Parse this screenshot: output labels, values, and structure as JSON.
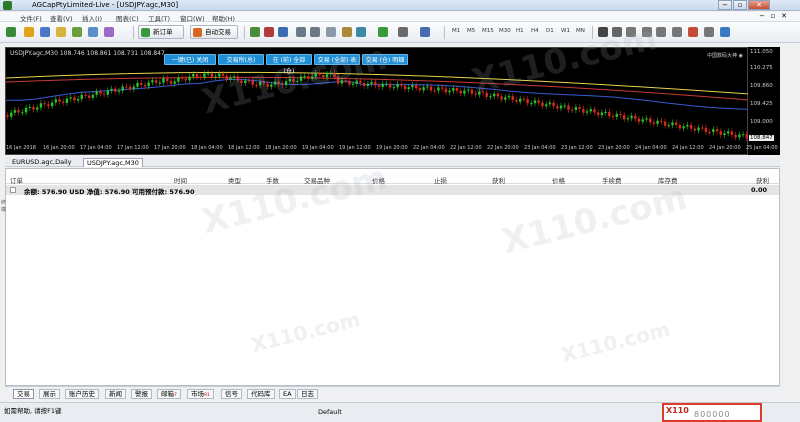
{
  "window": {
    "title": "AGCapPtyLimited-Live - [USDJPY.agc,M30]",
    "min_glyph": "−",
    "max_glyph": "▫",
    "close_glyph": "✕"
  },
  "menu": {
    "items": [
      "文件(F)",
      "查看(V)",
      "插入(I)",
      "图表(C)",
      "工具(T)",
      "窗口(W)",
      "帮助(H)"
    ],
    "right_min": "−",
    "right_restore": "▫",
    "right_close": "✕"
  },
  "toolbar": {
    "new_order_label": "新订单",
    "auto_trade_label": "自动交易",
    "timeframes": [
      "M1",
      "M5",
      "M15",
      "M30",
      "H1",
      "H4",
      "D1",
      "W1",
      "MN"
    ]
  },
  "chart": {
    "symbol_line": "USDJPY.agc,M30 108.746 108.861 108.731 108.847",
    "corner_label": "中国数码大神 ◉",
    "buttons": [
      "一键(已) 关闭",
      "交易所(总)",
      "在 (前) 全部 (仓)",
      "交易 (全部) 表",
      "交易 (仓) 明细"
    ],
    "prices": [
      "111.050",
      "110.275",
      "109.860",
      "109.425",
      "109.000",
      "108.580"
    ],
    "current_price": "108.847",
    "times": [
      "16 Jan 2018",
      "16 Jan 20:00",
      "17 Jan 04:00",
      "17 Jan 12:00",
      "17 Jan 20:00",
      "18 Jan 04:00",
      "18 Jan 12:00",
      "18 Jan 20:00",
      "19 Jan 04:00",
      "19 Jan 12:00",
      "19 Jan 20:00",
      "22 Jan 04:00",
      "22 Jan 12:00",
      "22 Jan 20:00",
      "23 Jan 04:00",
      "23 Jan 12:00",
      "23 Jan 20:00",
      "24 Jan 04:00",
      "24 Jan 12:00",
      "24 Jan 20:00",
      "25 Jan 04:00"
    ],
    "up_color": "#27c527",
    "down_color": "#d92a1c"
  },
  "chart_tabs": [
    "EURUSD.agc,Daily",
    "USDJPY.agc,M30"
  ],
  "terminal": {
    "columns": [
      "订单",
      "时间",
      "类型",
      "手数",
      "交易品种",
      "价格",
      "止损",
      "获利",
      "价格",
      "手续费",
      "库存费",
      "获利"
    ],
    "summary_text": "余额: 576.90 USD  净值: 576.90  可用预付款: 576.90",
    "summary_profit": "0.00",
    "side_label": "终端"
  },
  "bottom_tabs": [
    {
      "label": "交易",
      "sub": ""
    },
    {
      "label": "展示",
      "sub": ""
    },
    {
      "label": "账户历史",
      "sub": ""
    },
    {
      "label": "新闻",
      "sub": ""
    },
    {
      "label": "警报",
      "sub": ""
    },
    {
      "label": "邮箱",
      "sub": "7"
    },
    {
      "label": "市场",
      "sub": "91"
    },
    {
      "label": "信号",
      "sub": ""
    },
    {
      "label": "代码库",
      "sub": ""
    },
    {
      "label": "EA",
      "sub": ""
    },
    {
      "label": "日志",
      "sub": ""
    }
  ],
  "statusbar": {
    "help_text": "如需帮助, 请按F1键",
    "profile": "Default",
    "badge": "X110",
    "number": "800000"
  },
  "watermark": "X110.com"
}
